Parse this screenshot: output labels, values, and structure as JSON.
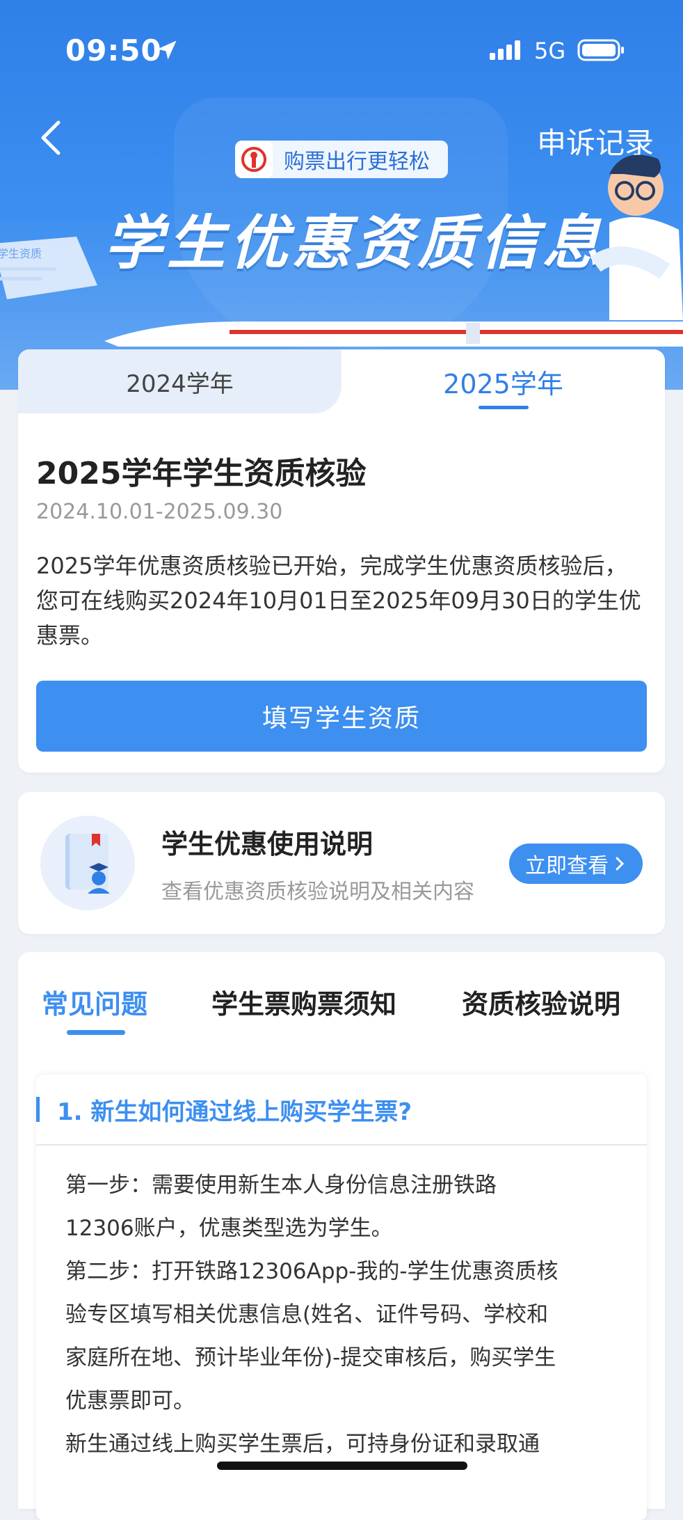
{
  "status_bar": {
    "time": "09:50",
    "network": "5G"
  },
  "header": {
    "appeal_label": "申诉记录",
    "slogan": "购票出行更轻松",
    "title": "学生优惠资质信息",
    "paper_text": "学生资质"
  },
  "year_tabs": [
    {
      "label": "2024学年",
      "active": false
    },
    {
      "label": "2025学年",
      "active": true
    }
  ],
  "verification": {
    "title": "2025学年学生资质核验",
    "date_range": "2024.10.01-2025.09.30",
    "description": "2025学年优惠资质核验已开始，完成学生优惠资质核验后，您可在线购买2024年10月01日至2025年09月30日的学生优惠票。",
    "button_label": "填写学生资质"
  },
  "guide": {
    "title": "学生优惠使用说明",
    "subtitle": "查看优惠资质核验说明及相关内容",
    "button_label": "立即查看"
  },
  "faq_tabs": [
    {
      "label": "常见问题",
      "active": true
    },
    {
      "label": "学生票购票须知",
      "active": false
    },
    {
      "label": "资质核验说明",
      "active": false
    }
  ],
  "faq": {
    "question": "1. 新生如何通过线上购买学生票?",
    "answer_lines": [
      "第一步：需要使用新生本人身份信息注册铁路",
      "12306账户，优惠类型选为学生。",
      "第二步：打开铁路12306App-我的-学生优惠资质核",
      "验专区填写相关优惠信息(姓名、证件号码、学校和",
      "家庭所在地、预计毕业年份)-提交审核后，购买学生",
      "优惠票即可。",
      "新生通过线上购买学生票后，可持身份证和录取通"
    ]
  },
  "colors": {
    "primary": "#3d8ff0",
    "hero": "#2f7fe8"
  }
}
